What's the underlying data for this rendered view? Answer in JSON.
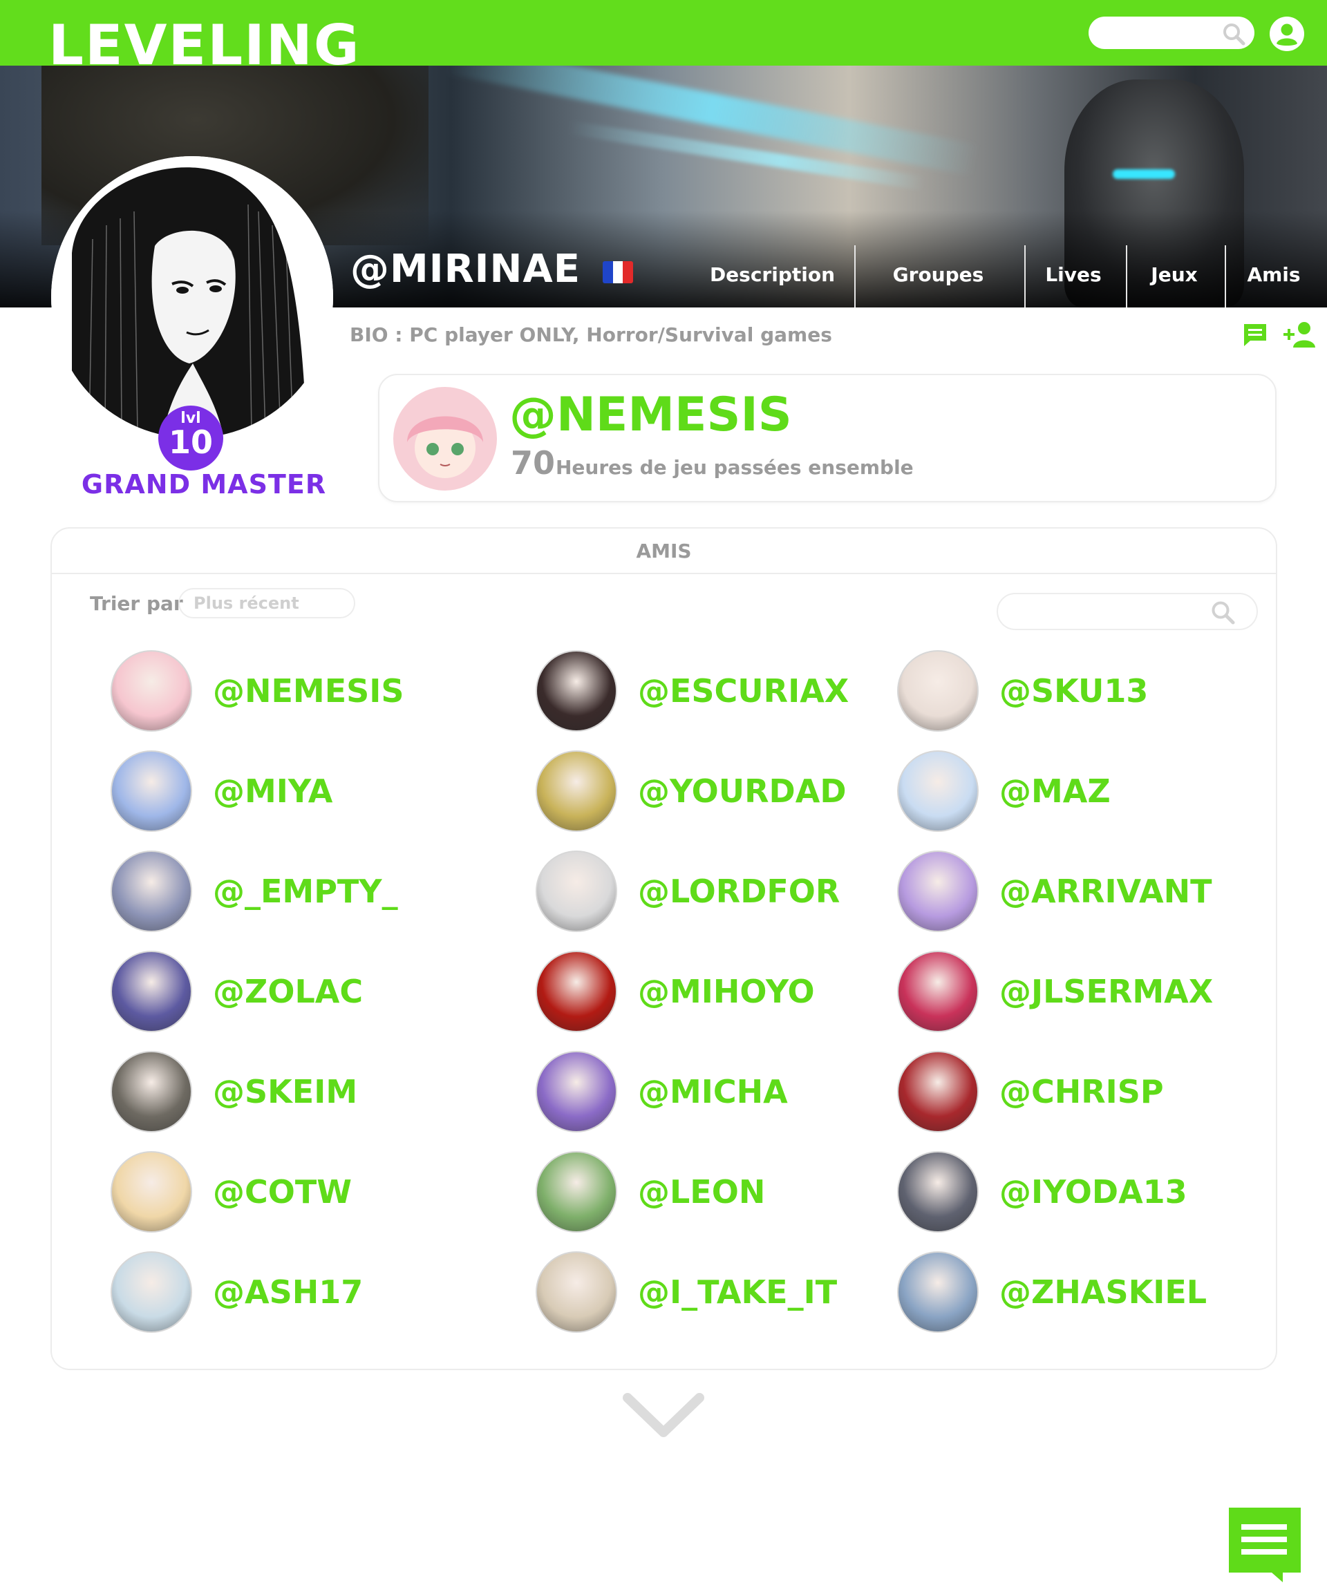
{
  "app": {
    "logo": "LEVELING"
  },
  "header": {
    "search_placeholder": "",
    "search_icon": "search-icon",
    "account_icon": "account-icon"
  },
  "colors": {
    "brand_green": "#62dd1c",
    "name_green": "#5fdb19",
    "rank_purple": "#7b2fe6",
    "muted_gray": "#9a9a9a"
  },
  "profile": {
    "username": "@MIRINAE",
    "country_flag": "flag-france-icon",
    "level_prefix": "lvl",
    "level": "10",
    "rank": "GRAND MASTER",
    "bio": "BIO : PC player ONLY, Horror/Survival games"
  },
  "nav": {
    "items": [
      "Description",
      "Groupes",
      "Lives",
      "Jeux",
      "Amis"
    ]
  },
  "actions": {
    "message_icon": "message-icon",
    "add_friend_icon": "add-friend-icon"
  },
  "top_friend": {
    "name": "@NEMESIS",
    "hours": "70",
    "hours_label": "Heures de jeu passées ensemble"
  },
  "friends_panel": {
    "title": "AMIS",
    "sort_label": "Trier par",
    "sort_placeholder": "Plus récent",
    "search_placeholder": "",
    "friends": [
      {
        "name": "@NEMESIS",
        "color": "#f6c6cf"
      },
      {
        "name": "@ESCURIAX",
        "color": "#3a2b2b"
      },
      {
        "name": "@SKU13",
        "color": "#e9ddd6"
      },
      {
        "name": "@MIYA",
        "color": "#9fb7e8"
      },
      {
        "name": "@YOURDAD",
        "color": "#c9b35a"
      },
      {
        "name": "@MAZ",
        "color": "#c9dcf2"
      },
      {
        "name": "@_EMPTY_",
        "color": "#8e95b7"
      },
      {
        "name": "@LORDFOR",
        "color": "#d9d9da"
      },
      {
        "name": "@ARRIVANT",
        "color": "#b79be0"
      },
      {
        "name": "@ZOLAC",
        "color": "#5d5aa1"
      },
      {
        "name": "@MIHOYO",
        "color": "#b21b14"
      },
      {
        "name": "@JLSERMAX",
        "color": "#c9325a"
      },
      {
        "name": "@SKEIM",
        "color": "#6e6a62"
      },
      {
        "name": "@MICHA",
        "color": "#8b6bc7"
      },
      {
        "name": "@CHRISP",
        "color": "#a8282d"
      },
      {
        "name": "@COTW",
        "color": "#f0d7a8"
      },
      {
        "name": "@LEON",
        "color": "#7fb06b"
      },
      {
        "name": "@IYODA13",
        "color": "#5f6270"
      },
      {
        "name": "@ASH17",
        "color": "#c9dbe6"
      },
      {
        "name": "@I_TAKE_IT",
        "color": "#d8cbb6"
      },
      {
        "name": "@ZHASKIEL",
        "color": "#8aa4c4"
      }
    ]
  },
  "footer": {
    "more_icon": "chevron-down-icon",
    "chat_icon": "chat-icon"
  }
}
